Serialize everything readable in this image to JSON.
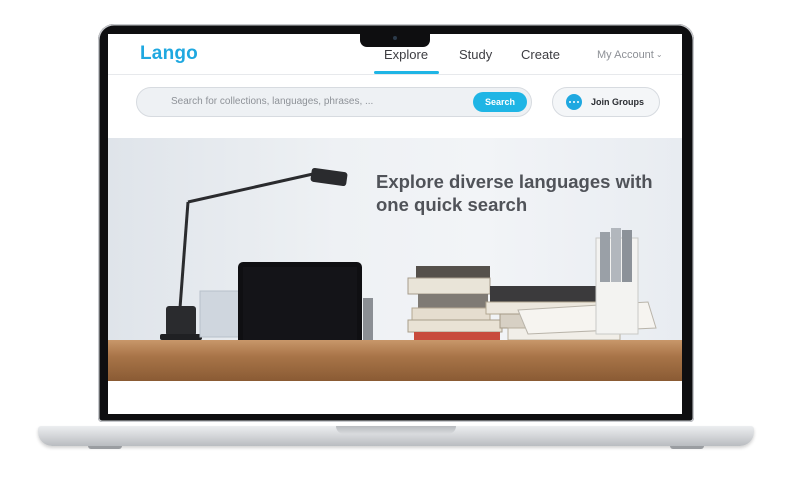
{
  "app": {
    "logo": "Lango"
  },
  "nav": {
    "items": [
      {
        "label": "Explore",
        "active": true
      },
      {
        "label": "Study",
        "active": false
      },
      {
        "label": "Create",
        "active": false
      }
    ],
    "account_label": "My Account"
  },
  "search": {
    "placeholder": "Search for collections, languages, phrases, ...",
    "button_label": "Search"
  },
  "groups": {
    "button_label": "Join Groups",
    "icon": "chat-bubble-icon"
  },
  "hero": {
    "headline_line1": "Explore diverse languages with",
    "headline_line2": "one quick search"
  },
  "colors": {
    "accent": "#1fb5e5",
    "logo": "#1fa8e0",
    "hero_text": "#505359"
  }
}
